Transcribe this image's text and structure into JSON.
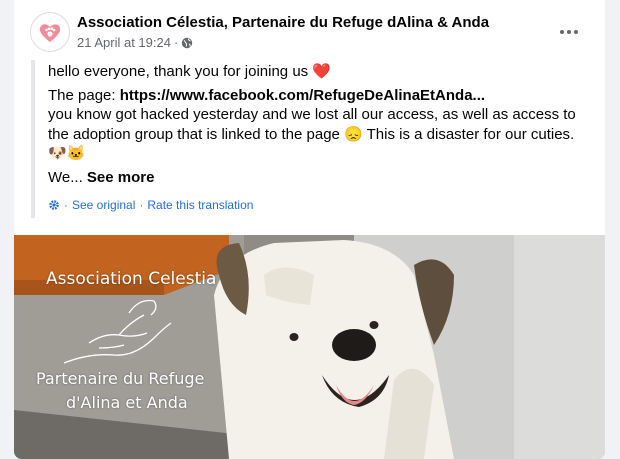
{
  "post": {
    "page_name": "Association Célestia, Partenaire du Refuge dAlina & Anda",
    "timestamp": "21 April at 19:24",
    "dot": "·",
    "privacy_icon": "globe-icon",
    "more_icon": "more-options-icon",
    "avatar_icon": "heart-paw-logo",
    "text": {
      "line1": "hello everyone, thank you for joining us",
      "heart_emoji": "❤️",
      "page_label": "The page: ",
      "page_link": "https://www.facebook.com/RefugeDeAlinaEtAnda...",
      "line3": "you know got hacked yesterday and we lost all our access, as well as access to",
      "line4": "the adoption group that is linked to the page",
      "sad_emoji": "😞",
      "line4_end": " This is a disaster for our cuties.",
      "animal_emojis": "🐶🐱",
      "we_text": "We... ",
      "see_more": "See more"
    },
    "translation": {
      "see_original": "See original",
      "separator": "·",
      "rate": "Rate this translation"
    },
    "photo": {
      "watermark_line1": "Association Celestia",
      "watermark_line2": "Partenaire du Refuge",
      "watermark_line3": "d'Alina et Anda"
    }
  },
  "colors": {
    "link": "#216fdb",
    "text": "#050505",
    "secondary": "#65676b",
    "background": "#f0f2f5",
    "card": "#ffffff"
  }
}
